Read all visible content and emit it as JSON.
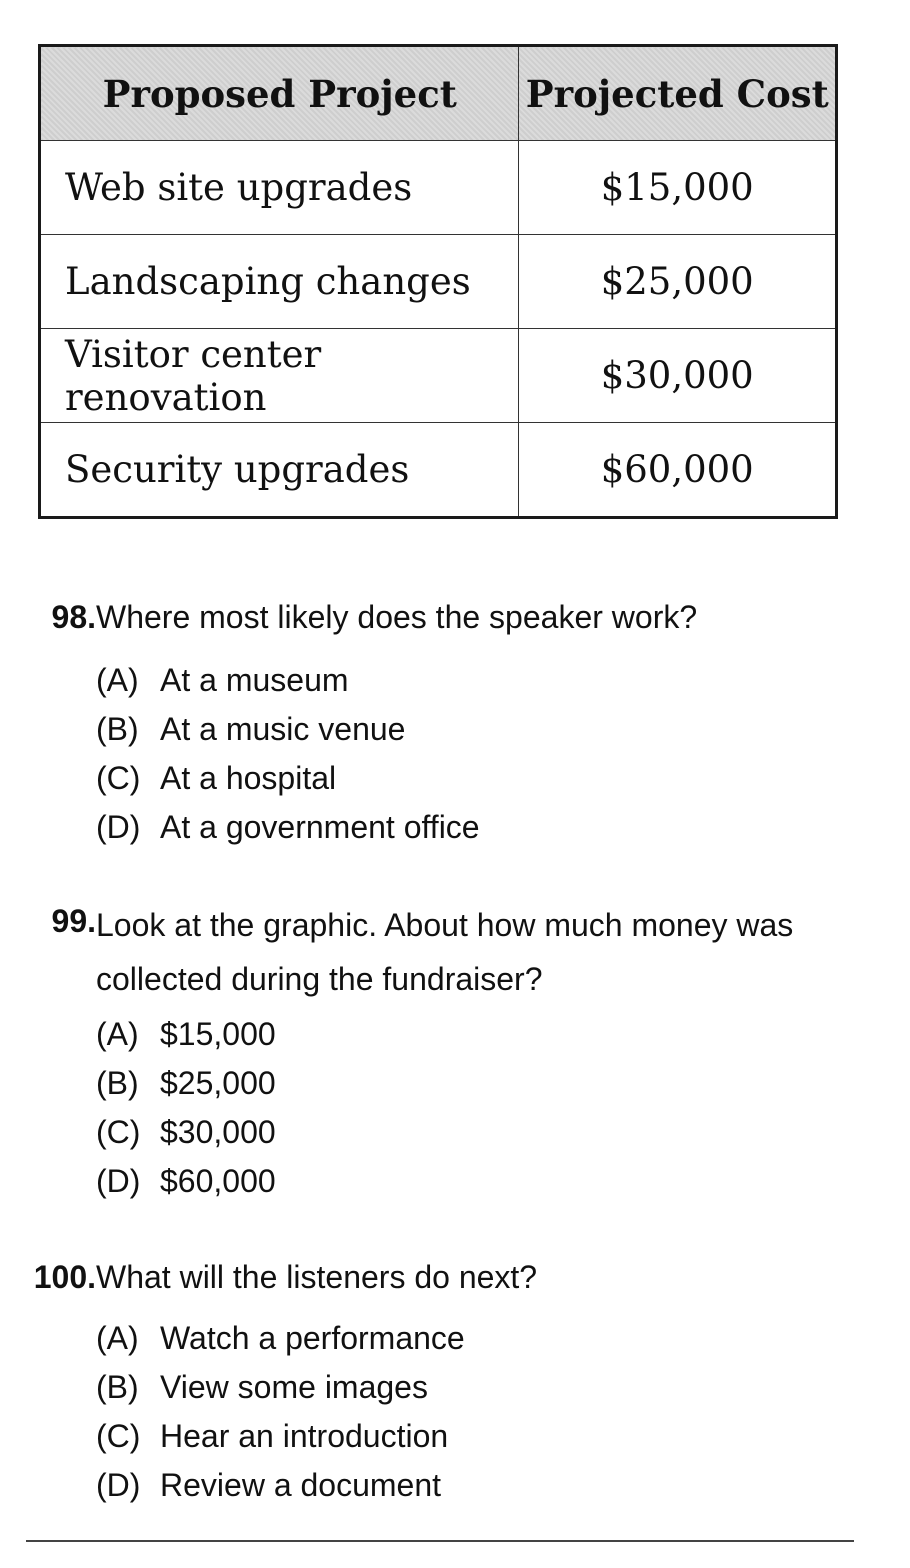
{
  "table": {
    "headers": [
      "Proposed Project",
      "Projected Cost"
    ],
    "rows": [
      {
        "project": "Web site upgrades",
        "cost": "$15,000"
      },
      {
        "project": "Landscaping changes",
        "cost": "$25,000"
      },
      {
        "project": "Visitor center renovation",
        "cost": "$30,000"
      },
      {
        "project": "Security upgrades",
        "cost": "$60,000"
      }
    ]
  },
  "questions": [
    {
      "number": "98.",
      "text": "Where most likely does the speaker work?",
      "options": [
        {
          "letter": "(A)",
          "text": "At a museum"
        },
        {
          "letter": "(B)",
          "text": "At a music venue"
        },
        {
          "letter": "(C)",
          "text": "At a hospital"
        },
        {
          "letter": "(D)",
          "text": "At a government office"
        }
      ]
    },
    {
      "number": "99.",
      "text": "Look at the graphic. About how much  money was collected during the fundraiser?",
      "options": [
        {
          "letter": "(A)",
          "text": "$15,000"
        },
        {
          "letter": "(B)",
          "text": "$25,000"
        },
        {
          "letter": "(C)",
          "text": "$30,000"
        },
        {
          "letter": "(D)",
          "text": "$60,000"
        }
      ]
    },
    {
      "number": "100.",
      "text": "What will the listeners do next?",
      "options": [
        {
          "letter": "(A)",
          "text": "Watch a performance"
        },
        {
          "letter": "(B)",
          "text": "View some images"
        },
        {
          "letter": "(C)",
          "text": "Hear an introduction"
        },
        {
          "letter": "(D)",
          "text": "Review a document"
        }
      ]
    }
  ]
}
